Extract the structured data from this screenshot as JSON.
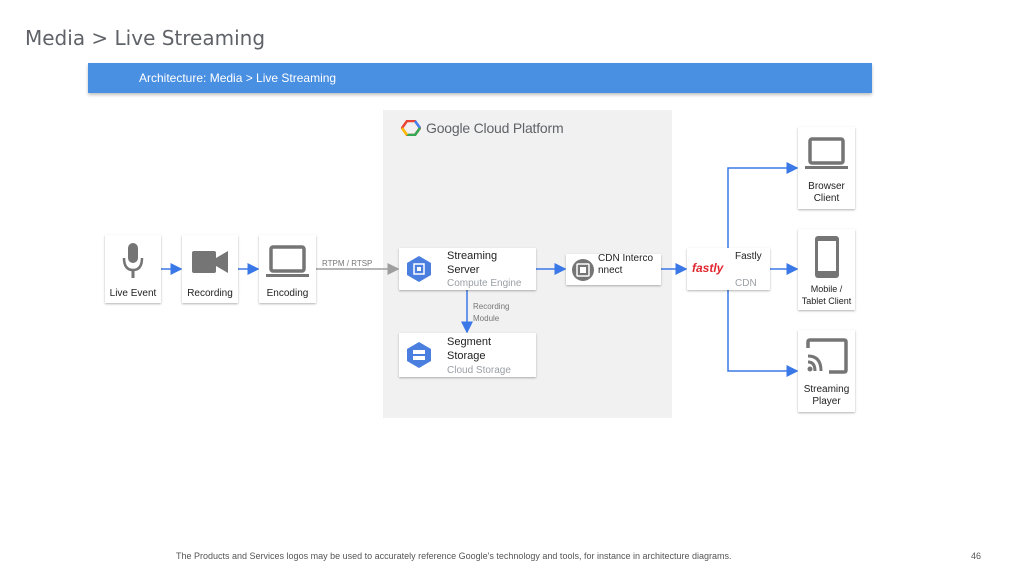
{
  "page_title": "Media > Live Streaming",
  "banner": "Architecture: Media > Live Streaming",
  "gcp_logo": "Google Cloud Platform",
  "nodes": {
    "live_event": "Live Event",
    "recording": "Recording",
    "encoding": "Encoding",
    "streaming_server": {
      "name": "Streaming Server",
      "sub": "Compute Engine"
    },
    "cdn_interconnect": {
      "name": "CDN Interconnect"
    },
    "fastly": {
      "name": "Fastly",
      "sub": "CDN",
      "logo": "fastly"
    },
    "segment_storage": {
      "name": "Segment Storage",
      "sub": "Cloud Storage"
    },
    "browser_client": "Browser Client",
    "mobile_client": "Mobile / Tablet Client",
    "streaming_player": "Streaming Player"
  },
  "edges": {
    "rtpm": "RTPM / RTSP",
    "recording_module": "Recording Module"
  },
  "colors": {
    "accent": "#4a90e2",
    "arrow": "#3b78e7",
    "gray_arrow": "#9e9e9e",
    "icon_gray": "#757575",
    "fastly_red": "#e0262f",
    "hex_blue": "#4a7fe0"
  },
  "footer": "The Products and Services logos may be used to accurately reference Google's technology and tools, for instance in architecture diagrams.",
  "page_number": "46"
}
